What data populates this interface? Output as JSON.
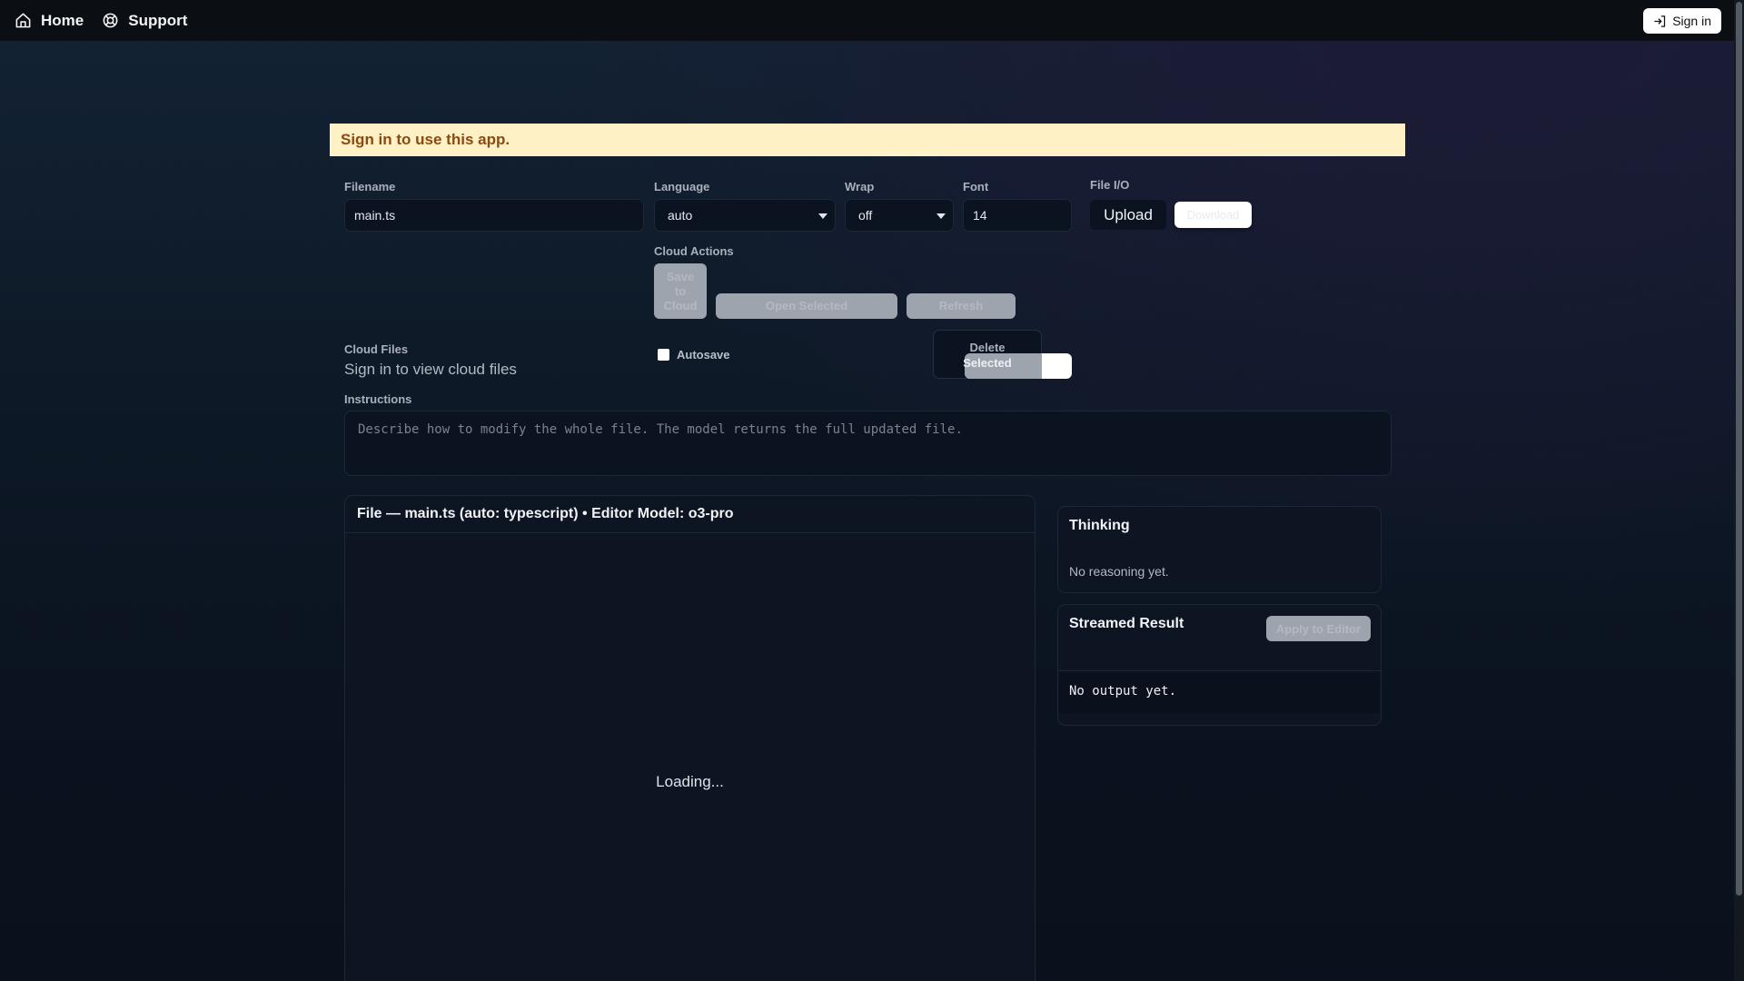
{
  "nav": {
    "home_label": "Home",
    "support_label": "Support",
    "signin_label": "Sign in"
  },
  "banner": {
    "text": "Sign in to use this app."
  },
  "form": {
    "filename_label": "Filename",
    "filename_value": "main.ts",
    "language_label": "Language",
    "language_value": "auto",
    "wrap_label": "Wrap",
    "wrap_value": "off",
    "font_label": "Font",
    "font_value": "14",
    "fileio_label": "File I/O",
    "upload_label": "Upload",
    "download_label": "Download"
  },
  "cloud": {
    "actions_label": "Cloud Actions",
    "save_label": "Save to Cloud",
    "open_label": "Open Selected",
    "refresh_label": "Refresh",
    "files_label": "Cloud Files",
    "files_placeholder": "Sign in to view cloud files",
    "autosave_label": "Autosave",
    "delete_label_1": "Delete",
    "delete_label_2": "Selected"
  },
  "instructions": {
    "label": "Instructions",
    "placeholder": "Describe how to modify the whole file. The model returns the full updated file."
  },
  "editor": {
    "title": "File — main.ts (auto: typescript) • Editor Model: o3-pro",
    "loading": "Loading..."
  },
  "thinking": {
    "title": "Thinking",
    "text": "No reasoning yet."
  },
  "result": {
    "title": "Streamed Result",
    "apply_label": "Apply to Editor",
    "text": "No output yet."
  }
}
